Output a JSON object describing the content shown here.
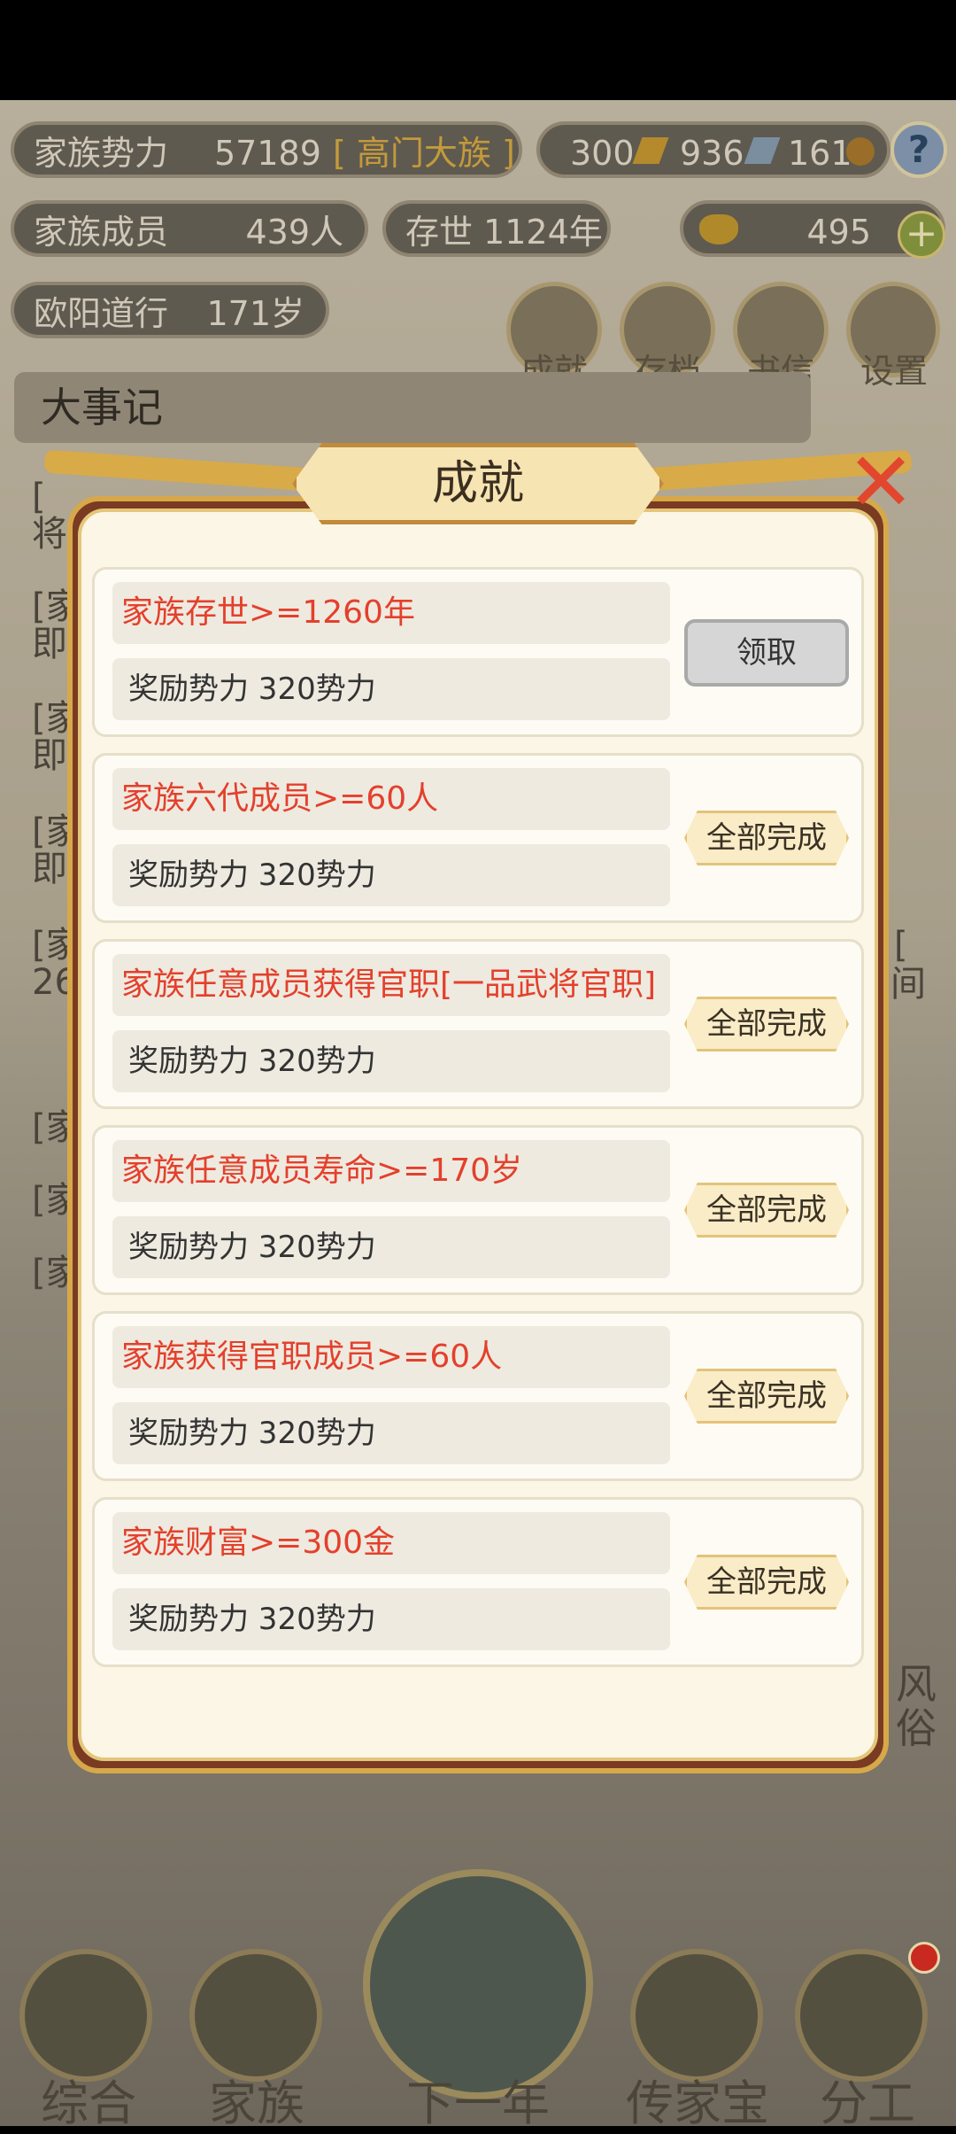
{
  "background": {
    "stats": {
      "family_power_label": "家族势力",
      "family_power_value": "57189",
      "family_rank": "[ 高门大族 ]",
      "members_label": "家族成员",
      "members_value": "439人",
      "existence": "存世 1124年",
      "leader": "欧阳道行",
      "leader_age": "171岁"
    },
    "resources": {
      "gold_bars": "300",
      "silver_bars": "936",
      "coins": "161",
      "ingots": "495",
      "help": "?",
      "plus": "+"
    },
    "top_icons": [
      {
        "label": "成就"
      },
      {
        "label": "存档"
      },
      {
        "label": "书信"
      },
      {
        "label": "设置"
      }
    ],
    "events_title": "大事记",
    "log_fragments": [
      "[",
      "将",
      "[家",
      "即",
      "[家",
      "即",
      "[家",
      "即",
      "[家",
      "26",
      "[家",
      "[家",
      "[家",
      "[家"
    ],
    "right_fragments": [
      "[",
      "间"
    ],
    "side_labels": [
      "风",
      "俗"
    ],
    "bottom_nav": [
      {
        "label": "综合"
      },
      {
        "label": "家族"
      },
      {
        "label": "下一年"
      },
      {
        "label": "传家宝"
      },
      {
        "label": "分工"
      }
    ]
  },
  "dialog": {
    "title": "成就",
    "achievements": [
      {
        "title": "家族存世>=1260年",
        "reward": "奖励势力 320势力",
        "button": "领取",
        "state": "claimable"
      },
      {
        "title": "家族六代成员>=60人",
        "reward": "奖励势力 320势力",
        "button": "全部完成",
        "state": "done"
      },
      {
        "title": "家族任意成员获得官职[一品武将官职]",
        "reward": "奖励势力 320势力",
        "button": "全部完成",
        "state": "done"
      },
      {
        "title": "家族任意成员寿命>=170岁",
        "reward": "奖励势力 320势力",
        "button": "全部完成",
        "state": "done"
      },
      {
        "title": "家族获得官职成员>=60人",
        "reward": "奖励势力 320势力",
        "button": "全部完成",
        "state": "done"
      },
      {
        "title": "家族财富>=300金",
        "reward": "奖励势力 320势力",
        "button": "全部完成",
        "state": "done"
      }
    ]
  },
  "colors": {
    "achievement_title": "#e4402c",
    "dialog_border": "#d7a84a",
    "dialog_frame": "#7a3b22"
  }
}
